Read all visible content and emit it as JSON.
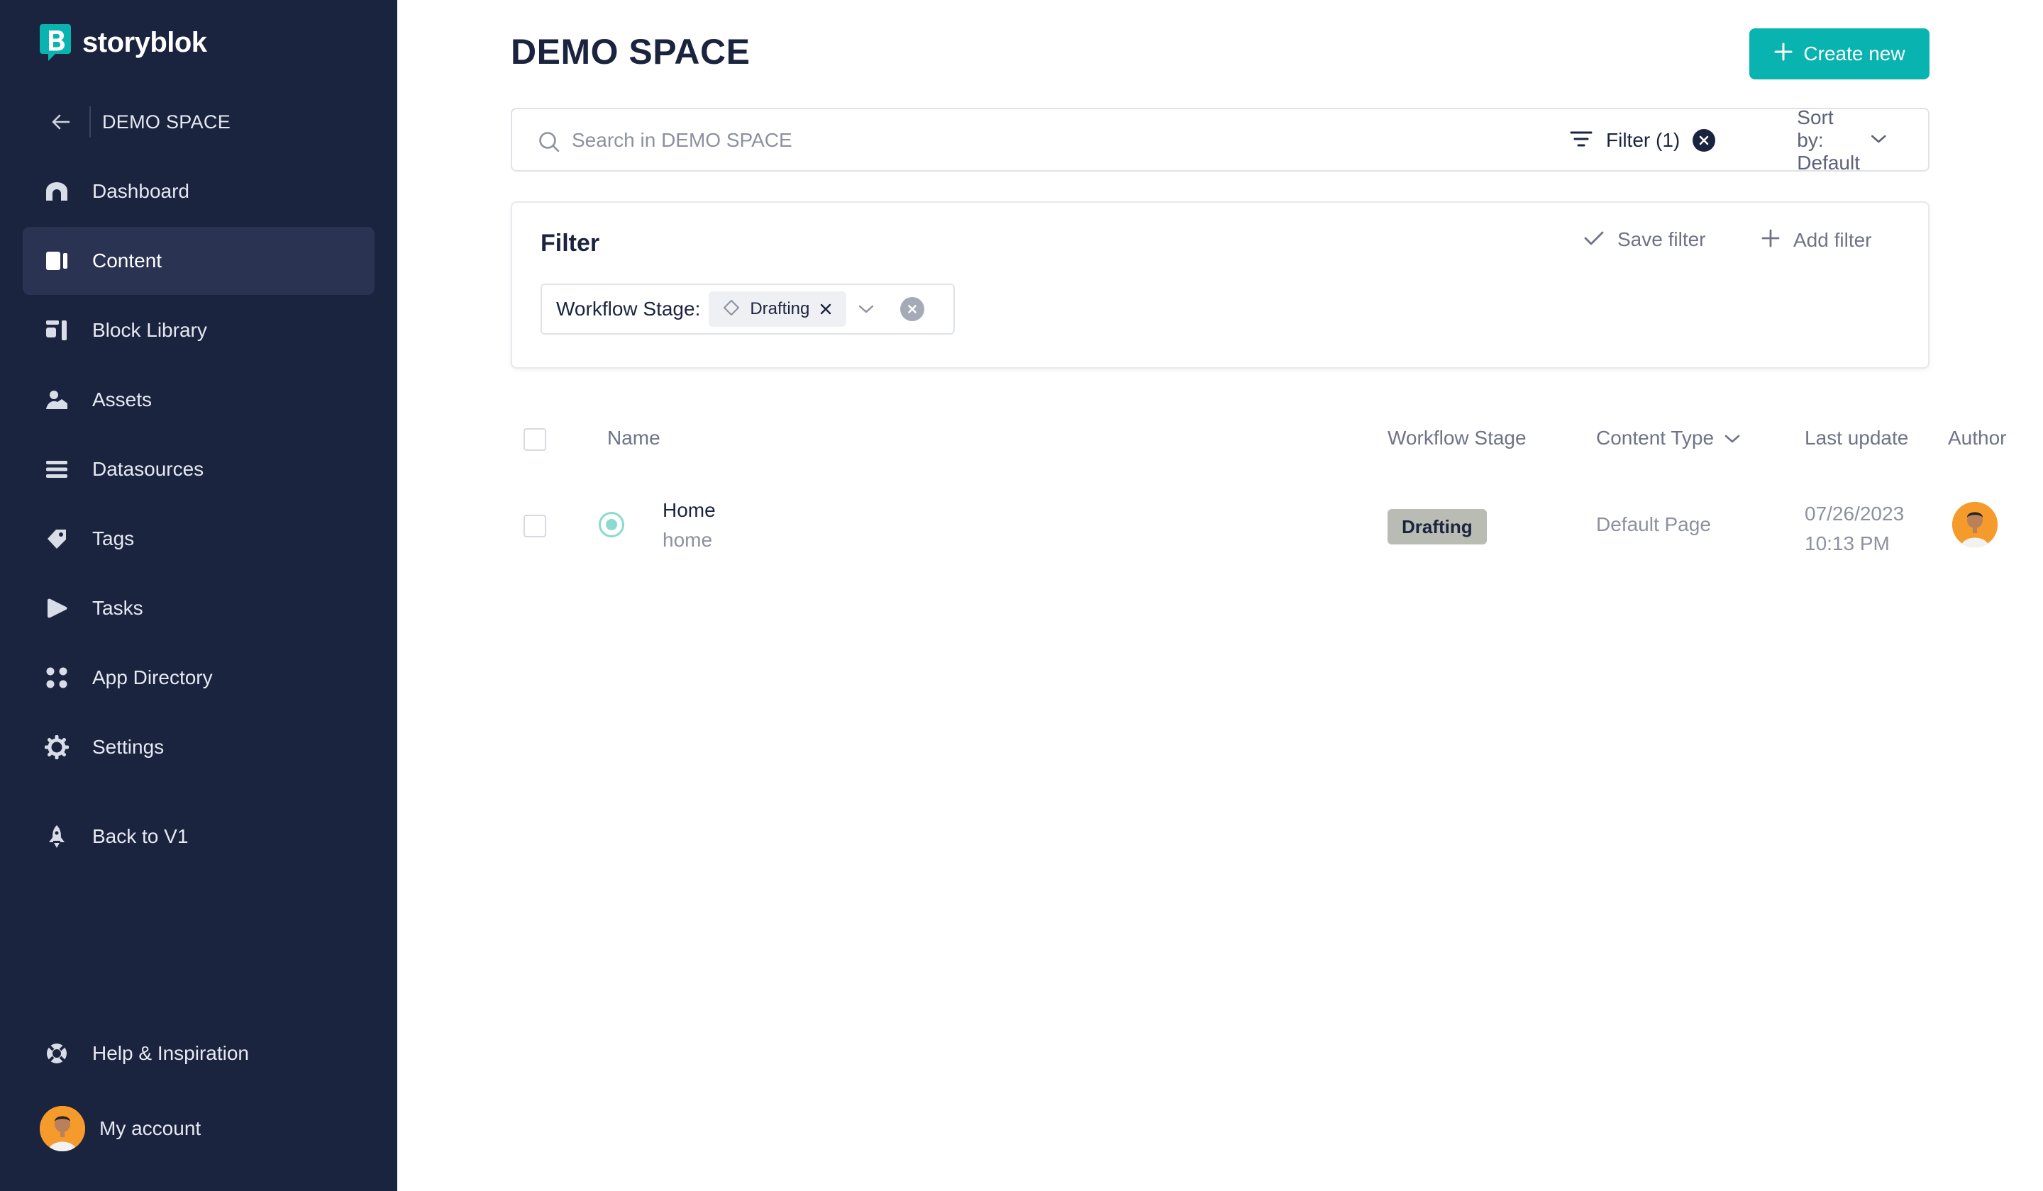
{
  "brand": {
    "name": "storyblok",
    "accent": "#09b3af"
  },
  "sidebar": {
    "space_name": "DEMO SPACE",
    "items": [
      {
        "label": "Dashboard",
        "icon": "dashboard-icon"
      },
      {
        "label": "Content",
        "icon": "content-icon",
        "active": true
      },
      {
        "label": "Block Library",
        "icon": "block-library-icon"
      },
      {
        "label": "Assets",
        "icon": "assets-icon"
      },
      {
        "label": "Datasources",
        "icon": "datasources-icon"
      },
      {
        "label": "Tags",
        "icon": "tags-icon"
      },
      {
        "label": "Tasks",
        "icon": "tasks-icon"
      },
      {
        "label": "App Directory",
        "icon": "app-directory-icon"
      },
      {
        "label": "Settings",
        "icon": "settings-icon"
      },
      {
        "label": "Back to V1",
        "icon": "rocket-icon"
      }
    ],
    "help_label": "Help & Inspiration",
    "account_label": "My account"
  },
  "header": {
    "title": "DEMO SPACE",
    "create_label": "Create new"
  },
  "search": {
    "placeholder": "Search in DEMO SPACE",
    "value": "",
    "filter_label": "Filter (1)",
    "sort_label": "Sort by: Default"
  },
  "filter_panel": {
    "title": "Filter",
    "save_label": "Save filter",
    "add_label": "Add filter",
    "chip": {
      "key": "Workflow Stage:",
      "value": "Drafting"
    }
  },
  "table": {
    "columns": {
      "name": "Name",
      "workflow_stage": "Workflow Stage",
      "content_type": "Content Type",
      "last_update": "Last update",
      "author": "Author"
    },
    "rows": [
      {
        "title": "Home",
        "slug": "home",
        "workflow_stage": "Drafting",
        "content_type": "Default Page",
        "date": "07/26/2023",
        "time": "10:13 PM"
      }
    ]
  }
}
